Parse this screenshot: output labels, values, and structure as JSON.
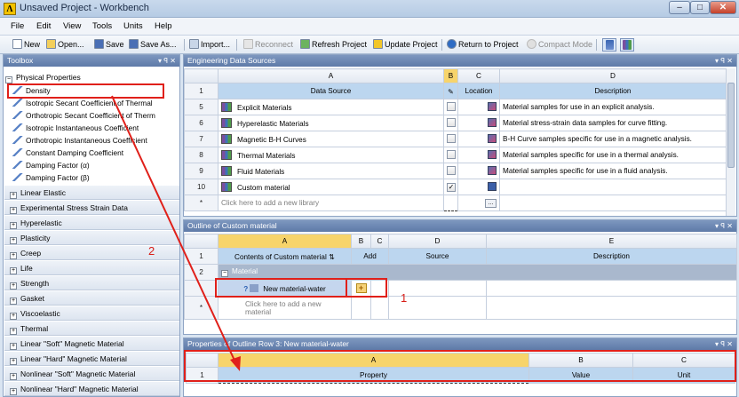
{
  "window": {
    "title": "Unsaved Project - Workbench",
    "minimize": "–",
    "maximize": "□",
    "close": "✕"
  },
  "menu": [
    "File",
    "Edit",
    "View",
    "Tools",
    "Units",
    "Help"
  ],
  "toolbar": {
    "new": "New",
    "open": "Open...",
    "save": "Save",
    "save_as": "Save As...",
    "import": "Import...",
    "reconnect": "Reconnect",
    "refresh": "Refresh Project",
    "update": "Update Project",
    "return": "Return to Project",
    "compact": "Compact Mode"
  },
  "toolbox": {
    "title": "Toolbox",
    "pin": "▾ ꟼ ✕",
    "section": "Physical Properties",
    "items": [
      "Density",
      "Isotropic Secant Coefficient of Thermal",
      "Orthotropic Secant Coefficient of Therm",
      "Isotropic Instantaneous Coefficient",
      "Orthotropic Instantaneous Coefficient",
      "Constant Damping Coefficient",
      "Damping Factor (α)",
      "Damping Factor (β)"
    ],
    "categories": [
      "Linear Elastic",
      "Experimental Stress Strain Data",
      "Hyperelastic",
      "Plasticity",
      "Creep",
      "Life",
      "Strength",
      "Gasket",
      "Viscoelastic",
      "Thermal",
      "Linear \"Soft\" Magnetic Material",
      "Linear \"Hard\" Magnetic Material",
      "Nonlinear \"Soft\" Magnetic Material",
      "Nonlinear \"Hard\" Magnetic Material"
    ]
  },
  "eds": {
    "title": "Engineering Data Sources",
    "cols": [
      "A",
      "B",
      "C",
      "D"
    ],
    "header": {
      "num": "1",
      "source": "Data Source",
      "location": "Location",
      "description": "Description"
    },
    "rows": [
      {
        "num": "5",
        "name": "Explicit Materials",
        "desc": "Material samples for use in an explicit analysis."
      },
      {
        "num": "6",
        "name": "Hyperelastic Materials",
        "desc": "Material stress-strain data samples for curve fitting."
      },
      {
        "num": "7",
        "name": "Magnetic B-H Curves",
        "desc": "B-H Curve samples specific for use in a magnetic analysis."
      },
      {
        "num": "8",
        "name": "Thermal Materials",
        "desc": "Material samples specific for use in a thermal analysis."
      },
      {
        "num": "9",
        "name": "Fluid Materials",
        "desc": "Material samples specific for use in a fluid analysis."
      },
      {
        "num": "10",
        "name": "Custom material",
        "desc": ""
      }
    ],
    "add_row": {
      "num": "*",
      "text": "Click here to add a new library",
      "ellipsis": "..."
    }
  },
  "outline": {
    "title": "Outline of Custom material",
    "cols": [
      "A",
      "B",
      "C",
      "D",
      "E"
    ],
    "header": {
      "num": "1",
      "contents": "Contents of Custom material",
      "add": "Add",
      "source": "Source",
      "description": "Description"
    },
    "group": {
      "num": "2",
      "label": "Material"
    },
    "material": "New material-water",
    "add_row": {
      "num": "*",
      "text": "Click here to add a new material"
    }
  },
  "properties": {
    "title": "Properties of Outline Row 3: New material-water",
    "cols": [
      "A",
      "B",
      "C"
    ],
    "header": {
      "num": "1",
      "property": "Property",
      "value": "Value",
      "unit": "Unit"
    }
  },
  "annotations": {
    "label1": "1",
    "label2": "2"
  }
}
